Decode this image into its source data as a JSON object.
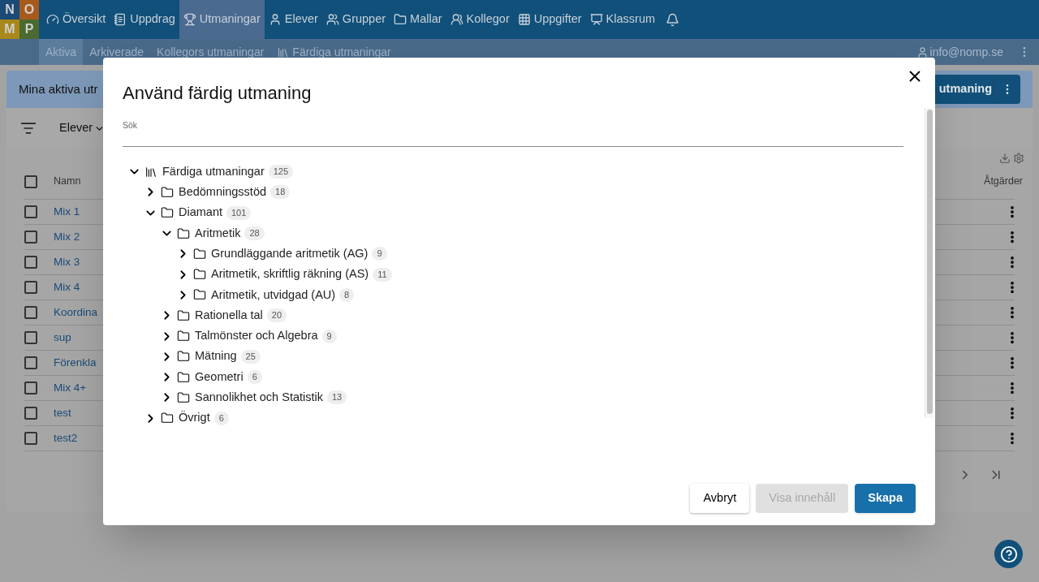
{
  "logo": {
    "letters": [
      "N",
      "O",
      "M",
      "P"
    ]
  },
  "nav": [
    {
      "label": "Översikt",
      "selected": false
    },
    {
      "label": "Uppdrag",
      "selected": false
    },
    {
      "label": "Utmaningar",
      "selected": true
    },
    {
      "label": "Elever",
      "selected": false
    },
    {
      "label": "Grupper",
      "selected": false
    },
    {
      "label": "Mallar",
      "selected": false
    },
    {
      "label": "Kollegor",
      "selected": false
    },
    {
      "label": "Uppgifter",
      "selected": false
    },
    {
      "label": "Klassrum",
      "selected": false
    }
  ],
  "subnav": {
    "tabs": [
      {
        "label": "Aktiva",
        "selected": true
      },
      {
        "label": "Arkiverade",
        "selected": false
      },
      {
        "label": "Kollegors utmaningar",
        "selected": false
      },
      {
        "label": "Färdiga utmaningar",
        "selected": false
      }
    ],
    "user": "info@nomp.se"
  },
  "page": {
    "banner_title": "Mina aktiva utr",
    "primary_button": "utmaning",
    "filter": "Elever",
    "table": {
      "columns": [
        "Namn",
        "Åtgärder"
      ],
      "select_all": {
        "checked": false
      },
      "rows": [
        {
          "name": "Mix 1",
          "checked": false
        },
        {
          "name": "Mix 2",
          "checked": false
        },
        {
          "name": "Mix 3",
          "checked": false
        },
        {
          "name": "Mix 4",
          "checked": false
        },
        {
          "name": "Koordina",
          "checked": false
        },
        {
          "name": "sup",
          "checked": false
        },
        {
          "name": "Förenkla",
          "checked": false
        },
        {
          "name": "Mix 4+",
          "checked": false
        },
        {
          "name": "test",
          "checked": false
        },
        {
          "name": "test2",
          "checked": false
        }
      ]
    }
  },
  "dialog": {
    "title": "Använd färdig utmaning",
    "search_label": "Sök",
    "tree": [
      {
        "kind": "collection",
        "label": "Färdiga utmaningar",
        "count": "125",
        "expanded": true,
        "children": [
          {
            "kind": "folder",
            "label": "Bedömningsstöd",
            "count": "18",
            "expanded": false
          },
          {
            "kind": "folder",
            "label": "Diamant",
            "count": "101",
            "expanded": true,
            "children": [
              {
                "kind": "folder",
                "label": "Aritmetik",
                "count": "28",
                "expanded": true,
                "children": [
                  {
                    "kind": "folder",
                    "label": "Grundläggande aritmetik (AG)",
                    "count": "9",
                    "expanded": false
                  },
                  {
                    "kind": "folder",
                    "label": "Aritmetik, skriftlig räkning (AS)",
                    "count": "11",
                    "expanded": false
                  },
                  {
                    "kind": "folder",
                    "label": "Aritmetik, utvidgad (AU)",
                    "count": "8",
                    "expanded": false
                  }
                ]
              },
              {
                "kind": "folder",
                "label": "Rationella tal",
                "count": "20",
                "expanded": false
              },
              {
                "kind": "folder",
                "label": "Talmönster och Algebra",
                "count": "9",
                "expanded": false
              },
              {
                "kind": "folder",
                "label": "Mätning",
                "count": "25",
                "expanded": false
              },
              {
                "kind": "folder",
                "label": "Geometri",
                "count": "6",
                "expanded": false
              },
              {
                "kind": "folder",
                "label": "Sannolikhet och Statistik",
                "count": "13",
                "expanded": false
              }
            ]
          },
          {
            "kind": "folder",
            "label": "Övrigt",
            "count": "6",
            "expanded": false
          }
        ]
      }
    ],
    "buttons": [
      {
        "label": "Avbryt",
        "kind": "outlined",
        "disabled": false
      },
      {
        "label": "Visa innehåll",
        "kind": "flat",
        "disabled": true
      },
      {
        "label": "Skapa",
        "kind": "primary",
        "disabled": false
      }
    ]
  }
}
